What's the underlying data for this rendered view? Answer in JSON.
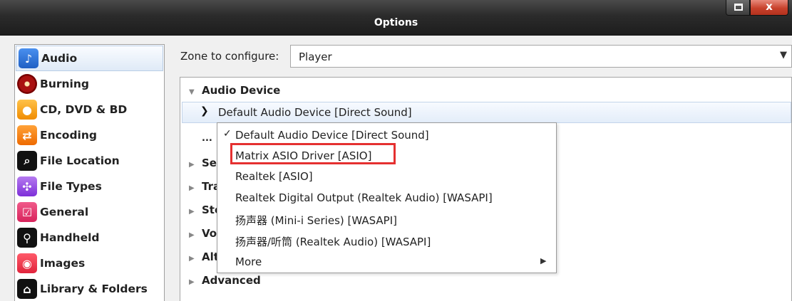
{
  "window": {
    "title": "Options",
    "maximize_label": "",
    "close_label": "x"
  },
  "sidebar": {
    "items": [
      {
        "label": "Audio",
        "icon": "music-note-icon",
        "glyph": "♪",
        "selected": true
      },
      {
        "label": "Burning",
        "icon": "disc-burn-icon",
        "glyph": "",
        "selected": false
      },
      {
        "label": "CD, DVD & BD",
        "icon": "cd-icon",
        "glyph": "●",
        "selected": false
      },
      {
        "label": "Encoding",
        "icon": "encoding-icon",
        "glyph": "⇄",
        "selected": false
      },
      {
        "label": "File Location",
        "icon": "file-location-icon",
        "glyph": "⌕",
        "selected": false
      },
      {
        "label": "File Types",
        "icon": "puzzle-icon",
        "glyph": "✣",
        "selected": false
      },
      {
        "label": "General",
        "icon": "checkbox-icon",
        "glyph": "☑",
        "selected": false
      },
      {
        "label": "Handheld",
        "icon": "usb-icon",
        "glyph": "⚲",
        "selected": false
      },
      {
        "label": "Images",
        "icon": "camera-icon",
        "glyph": "◉",
        "selected": false
      },
      {
        "label": "Library & Folders",
        "icon": "home-icon",
        "glyph": "⌂",
        "selected": false
      }
    ]
  },
  "zone": {
    "label": "Zone to configure:",
    "value": "Player"
  },
  "tree": {
    "audio_device_header": "Audio Device",
    "device_selected": "Default Audio Device [Direct Sound]",
    "ellipsis": "...",
    "collapsed_items": [
      {
        "label": "Se"
      },
      {
        "label": "Tra"
      },
      {
        "label": "Sto"
      },
      {
        "label": "Vo"
      },
      {
        "label": "Alt"
      },
      {
        "label": "Advanced"
      }
    ]
  },
  "device_dropdown": {
    "options": [
      {
        "label": "Default Audio Device [Direct Sound]",
        "checked": true
      },
      {
        "label": "Matrix ASIO Driver [ASIO]",
        "checked": false,
        "highlighted": true
      },
      {
        "label": "Realtek [ASIO]",
        "checked": false
      },
      {
        "label": "Realtek Digital Output (Realtek Audio) [WASAPI]",
        "checked": false
      },
      {
        "label": "扬声器 (Mini-i Series) [WASAPI]",
        "checked": false
      },
      {
        "label": "扬声器/听筒 (Realtek Audio) [WASAPI]",
        "checked": false
      },
      {
        "label": "More",
        "checked": false,
        "submenu": true
      }
    ],
    "check_glyph": "✓",
    "submenu_glyph": "▶",
    "highlight_color": "#e53030"
  },
  "colors": {
    "titlebar": "#2b2b2b",
    "close_button": "#c8412c",
    "selection": "#dfeaf7",
    "background": "#f0f0f0"
  }
}
